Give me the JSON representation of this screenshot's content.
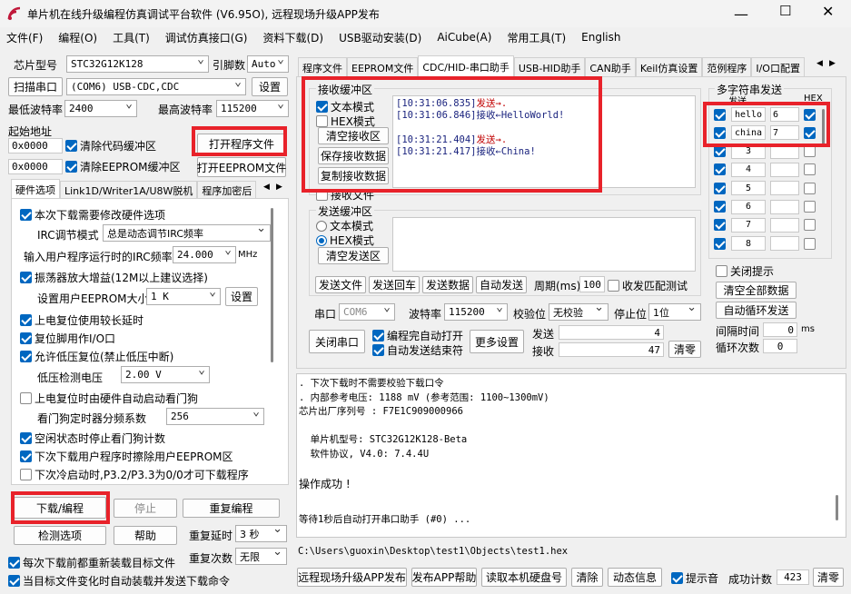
{
  "window": {
    "title": "单片机在线升级编程仿真调试平台软件 (V6.95O), 远程现场升级APP发布"
  },
  "menu": [
    "文件(F)",
    "编程(O)",
    "工具(T)",
    "调试仿真接口(G)",
    "资料下载(D)",
    "USB驱动安装(D)",
    "AiCube(A)",
    "常用工具(T)",
    "English"
  ],
  "left": {
    "chip_label": "芯片型号",
    "chip_value": "STC32G12K128",
    "pins_label": "引脚数",
    "pins_value": "Auto",
    "scan_button": "扫描串口",
    "port_value": "(COM6) USB-CDC,CDC",
    "settings_button": "设置",
    "min_baud_label": "最低波特率",
    "min_baud_value": "2400",
    "max_baud_label": "最高波特率",
    "max_baud_value": "115200",
    "start_addr_label": "起始地址",
    "addr1": "0x0000",
    "clear_code_label": "清除代码缓冲区",
    "open_program_button": "打开程序文件",
    "addr2": "0x0000",
    "clear_eeprom_label": "清除EEPROM缓冲区",
    "open_eeprom_button": "打开EEPROM文件",
    "tabs": [
      "硬件选项",
      "Link1D/Writer1A/U8W脱机",
      "程序加密后"
    ],
    "hw": {
      "opt1": "本次下载需要修改硬件选项",
      "irc_mode_label": "IRC调节模式",
      "irc_mode_value": "总是动态调节IRC频率",
      "irc_freq_label": "输入用户程序运行时的IRC频率",
      "irc_freq_value": "24.000",
      "irc_unit": "MHz",
      "opt2": "振荡器放大增益(12M以上建议选择)",
      "eeprom_size_label": "设置用户EEPROM大小",
      "eeprom_size_value": "1    K",
      "eeprom_set_button": "设置",
      "opt3": "上电复位使用较长延时",
      "opt4": "复位脚用作I/O口",
      "opt5": "允许低压复位(禁止低压中断)",
      "lvd_label": "低压检测电压",
      "lvd_value": "2.00 V",
      "opt6": "上电复位时由硬件自动启动看门狗",
      "wdt_label": "看门狗定时器分频系数",
      "wdt_value": "256",
      "opt7": "空闲状态时停止看门狗计数",
      "opt8": "下次下载用户程序时擦除用户EEPROM区",
      "opt9": "下次冷启动时,P3.2/P3.3为0/0才可下载程序"
    },
    "download_button": "下载/编程",
    "stop_button": "停止",
    "reprogram_button": "重复编程",
    "check_button": "检测选项",
    "help_button": "帮助",
    "repeat_delay_label": "重复延时",
    "repeat_delay_value": "3 秒",
    "repeat_count_label": "重复次数",
    "repeat_count_value": "无限",
    "reload_label": "每次下载前都重新装载目标文件",
    "auto_send_label": "当目标文件变化时自动装载并发送下载命令"
  },
  "right": {
    "tabs": [
      "程序文件",
      "EEPROM文件",
      "CDC/HID-串口助手",
      "USB-HID助手",
      "CAN助手",
      "Keil仿真设置",
      "范例程序",
      "I/O口配置"
    ],
    "recv_group": "接收缓冲区",
    "text_mode": "文本模式",
    "hex_mode": "HEX模式",
    "clear_recv": "清空接收区",
    "save_recv": "保存接收数据",
    "copy_recv": "复制接收数据",
    "recv_file": "接收文件",
    "log": [
      {
        "time": "[10:31:06.835]",
        "dir": "发送→",
        "msg": ".",
        "type": "send"
      },
      {
        "time": "[10:31:06.846]",
        "dir": "接收←",
        "msg": "HelloWorld!",
        "type": "recv"
      },
      {
        "time": "[10:31:21.404]",
        "dir": "发送→",
        "msg": ".",
        "type": "send"
      },
      {
        "time": "[10:31:21.417]",
        "dir": "接收←",
        "msg": "China!",
        "type": "recv"
      }
    ],
    "send_group": "发送缓冲区",
    "send_text_mode": "文本模式",
    "send_hex_mode": "HEX模式",
    "clear_send": "清空发送区",
    "send_file": "发送文件",
    "send_return": "发送回车",
    "send_data": "发送数据",
    "auto_send": "自动发送",
    "period_label": "周期(ms)",
    "period_value": "100",
    "match_label": "收发匹配测试",
    "port_label": "串口",
    "port_value": "COM6",
    "baud_label": "波特率",
    "baud_value": "115200",
    "parity_label": "校验位",
    "parity_value": "无校验",
    "stop_label": "停止位",
    "stop_value": "1位",
    "close_port": "关闭串口",
    "auto_open_label": "编程完自动打开",
    "auto_end_label": "自动发送结束符",
    "more_settings": "更多设置",
    "tx_label": "发送",
    "tx_value": "4",
    "rx_label": "接收",
    "rx_value": "47",
    "clear_count": "清零",
    "multi_group": "多字符串发送",
    "multi_hdr_send": "发送",
    "multi_hdr_hex": "HEX",
    "multi": [
      {
        "text": "hello",
        "num": "6",
        "hex": true
      },
      {
        "text": "china",
        "num": "7",
        "hex": true
      },
      {
        "text": "",
        "num": "3",
        "hex": false
      },
      {
        "text": "",
        "num": "4",
        "hex": false
      },
      {
        "text": "",
        "num": "5",
        "hex": false
      },
      {
        "text": "",
        "num": "6",
        "hex": false
      },
      {
        "text": "",
        "num": "7",
        "hex": false
      },
      {
        "text": "",
        "num": "8",
        "hex": false
      }
    ],
    "close_hint": "关闭提示",
    "clear_all": "清空全部数据",
    "auto_loop": "自动循环发送",
    "interval_label": "间隔时间",
    "interval_value": "0",
    "interval_unit": "ms",
    "loop_label": "循环次数",
    "loop_value": "0"
  },
  "output": {
    "lines": [
      ". 下次下载时不需要校验下载口令",
      ". 内部参考电压: 1188 mV (参考范围: 1100~1300mV)",
      "芯片出厂序列号 : F7E1C909000966",
      "",
      "  单片机型号: STC32G12K128-Beta",
      "  软件协议, V4.0: 7.4.4U",
      "",
      "操作成功 !",
      "",
      "等待1秒后自动打开串口助手 (#0) ..."
    ],
    "filepath": "C:\\Users\\guoxin\\Desktop\\test1\\Objects\\test1.hex"
  },
  "bottom": {
    "publish": "远程现场升级APP发布",
    "publish_help": "发布APP帮助",
    "read_disk": "读取本机硬盘号",
    "clear": "清除",
    "dynamic": "动态信息",
    "sound": "提示音",
    "success_label": "成功计数",
    "success_value": "423",
    "clear_count": "清零"
  }
}
